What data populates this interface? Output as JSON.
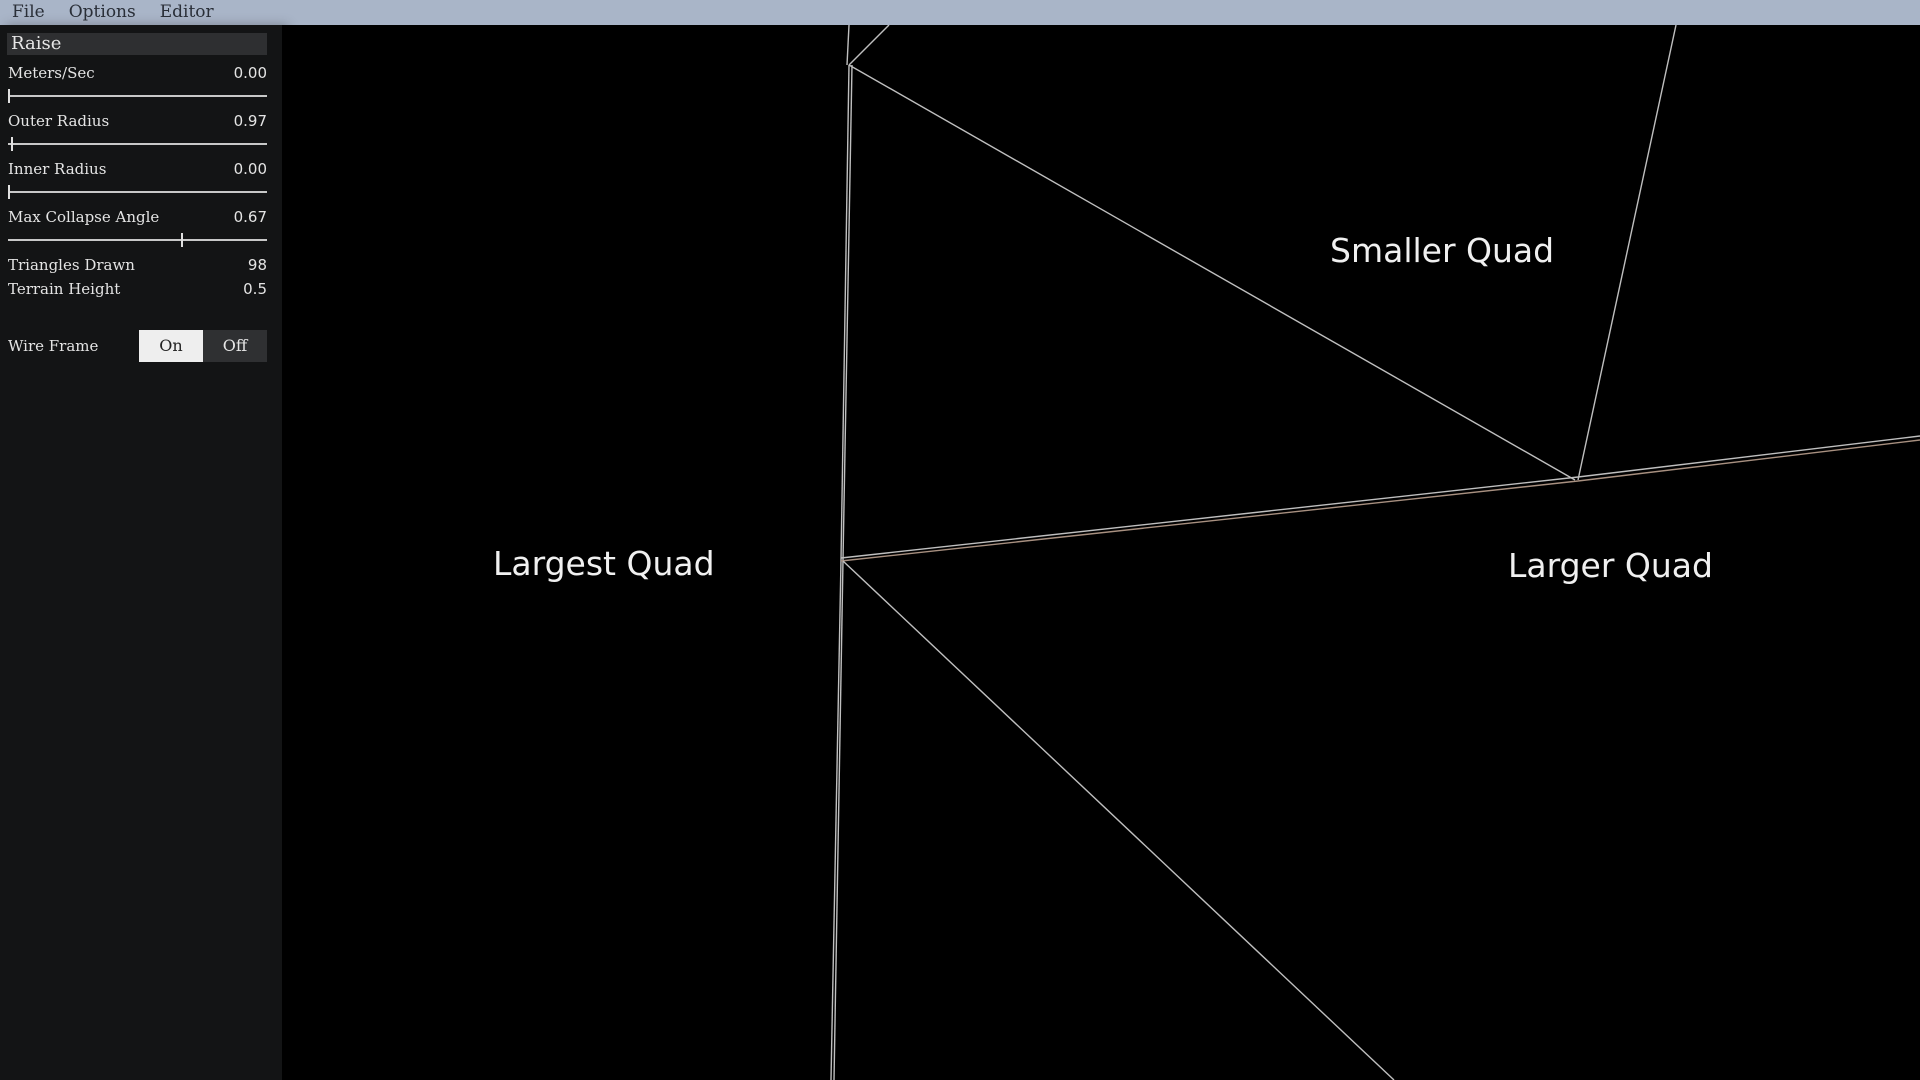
{
  "menu": {
    "items": [
      "File",
      "Options",
      "Editor"
    ]
  },
  "panel": {
    "title": "Raise",
    "sliders": [
      {
        "label": "Meters/Sec",
        "value": "0.00",
        "fraction": 0.0
      },
      {
        "label": "Outer Radius",
        "value": "0.97",
        "fraction": 0.015
      },
      {
        "label": "Inner Radius",
        "value": "0.00",
        "fraction": 0.0
      },
      {
        "label": "Max Collapse Angle",
        "value": "0.67",
        "fraction": 0.67
      }
    ],
    "stats": [
      {
        "label": "Triangles Drawn",
        "value": "98"
      },
      {
        "label": "Terrain Height",
        "value": "0.5"
      }
    ],
    "wireframe": {
      "label": "Wire Frame",
      "on_label": "On",
      "off_label": "Off",
      "selected": "On"
    }
  },
  "viewport": {
    "labels": {
      "largest": "Largest Quad",
      "smaller": "Smaller Quad",
      "larger": "Larger Quad"
    },
    "line_color": "#bfbfbf"
  }
}
